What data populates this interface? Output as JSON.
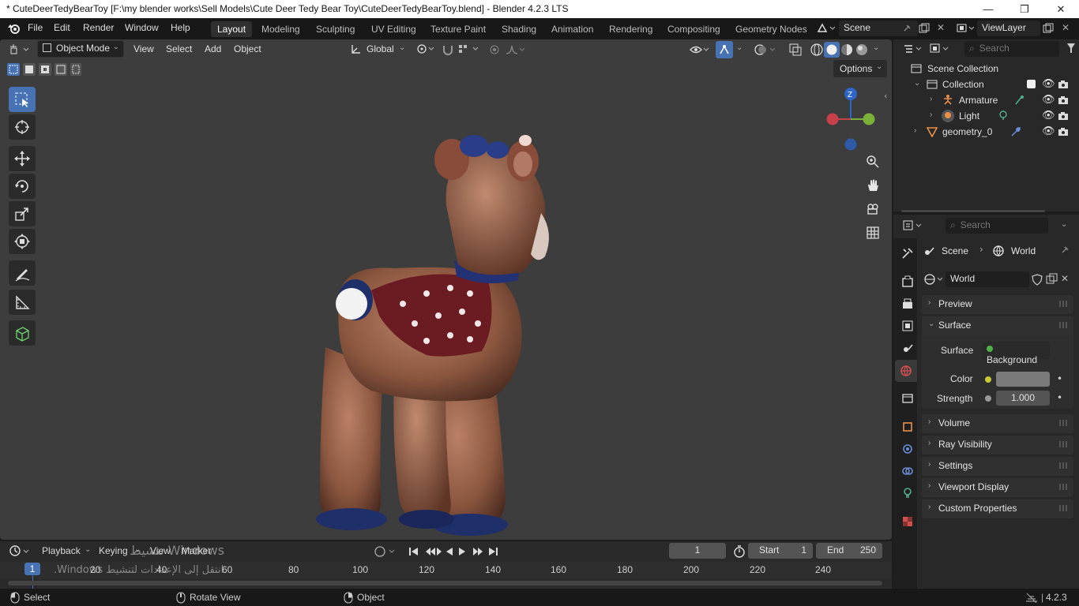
{
  "window": {
    "title": "* CuteDeerTedyBearToy [F:\\my blender works\\Sell Models\\Cute Deer Tedy Bear Toy\\CuteDeerTedyBearToy.blend] - Blender 4.2.3 LTS",
    "minimize": "—",
    "maximize": "❐",
    "close": "✕"
  },
  "menubar": {
    "items": [
      "File",
      "Edit",
      "Render",
      "Window",
      "Help"
    ],
    "workspace_tabs": [
      "Layout",
      "Modeling",
      "Sculpting",
      "UV Editing",
      "Texture Paint",
      "Shading",
      "Animation",
      "Rendering",
      "Compositing",
      "Geometry Nodes"
    ],
    "active_tab": "Layout",
    "scene": "Scene",
    "view_layer": "ViewLayer"
  },
  "viewport": {
    "mode": "Object Mode",
    "menus": [
      "View",
      "Select",
      "Add",
      "Object"
    ],
    "transform_orientation": "Global",
    "options_label": "Options",
    "gizmo_axes": {
      "z": "Z"
    }
  },
  "outliner": {
    "search_placeholder": "Search",
    "rows": [
      {
        "label": "Scene Collection"
      },
      {
        "label": "Collection"
      },
      {
        "label": "Armature"
      },
      {
        "label": "Light"
      },
      {
        "label": "geometry_0"
      }
    ]
  },
  "properties": {
    "search_placeholder": "Search",
    "breadcrumb": {
      "scene": "Scene",
      "world": "World"
    },
    "world_name": "World",
    "panels": {
      "preview": "Preview",
      "surface": "Surface",
      "volume": "Volume",
      "ray_visibility": "Ray Visibility",
      "settings": "Settings",
      "viewport_display": "Viewport Display",
      "custom_properties": "Custom Properties"
    },
    "surface_label": "Surface",
    "surface_value": "Background",
    "color_label": "Color",
    "color_value": "#7a7a7a",
    "strength_label": "Strength",
    "strength_value": "1.000"
  },
  "timeline": {
    "menus": [
      "Playback",
      "Keying",
      "View",
      "Marker"
    ],
    "current_frame": "1",
    "start_label": "Start",
    "start_value": "1",
    "end_label": "End",
    "end_value": "250",
    "playhead": "1",
    "ticks": [
      "20",
      "40",
      "60",
      "80",
      "100",
      "120",
      "140",
      "160",
      "180",
      "200",
      "220",
      "240"
    ],
    "watermark_line1": "تنشيط Windows",
    "watermark_line2": "انتقل إلى الإعدادات لتنشيط Windows."
  },
  "statusbar": {
    "select": "Select",
    "rotate_view": "Rotate View",
    "object": "Object",
    "version": "4.2.3"
  }
}
